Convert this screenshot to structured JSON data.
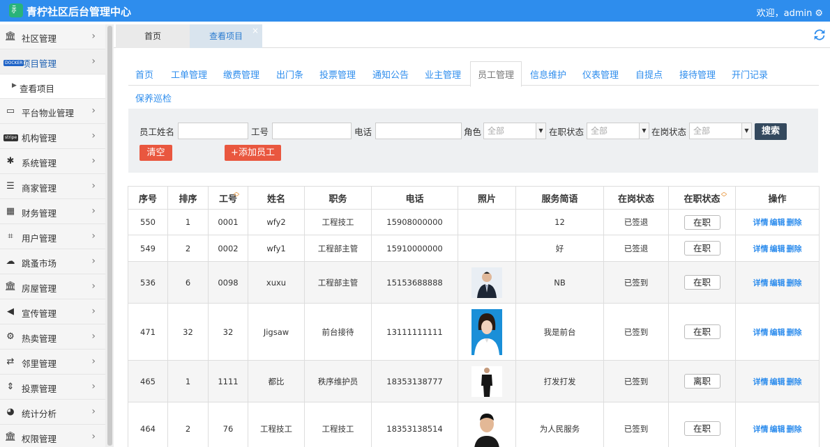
{
  "header": {
    "logo_glyph": "⺬",
    "title": "青柠社区后台管理中心",
    "welcome": "欢迎，admin",
    "settings_icon": "gear-icon"
  },
  "sidebar": {
    "items": [
      {
        "label": "社区管理",
        "icon": "bank-icon"
      },
      {
        "label": "项目管理",
        "icon": "docker-icon",
        "active": true
      },
      {
        "label": "查看项目",
        "sub": true
      },
      {
        "label": "平台物业管理",
        "icon": "desktop-icon"
      },
      {
        "label": "机构管理",
        "icon": "stripe-icon"
      },
      {
        "label": "系统管理",
        "icon": "yelp-icon"
      },
      {
        "label": "商家管理",
        "icon": "bars-icon"
      },
      {
        "label": "财务管理",
        "icon": "calculator-icon"
      },
      {
        "label": "用户管理",
        "icon": "crop-icon"
      },
      {
        "label": "跳蚤市场",
        "icon": "cloud-icon"
      },
      {
        "label": "房屋管理",
        "icon": "bank-icon"
      },
      {
        "label": "宣传管理",
        "icon": "volume-icon"
      },
      {
        "label": "热卖管理",
        "icon": "cog-icon"
      },
      {
        "label": "邻里管理",
        "icon": "retweet-icon"
      },
      {
        "label": "投票管理",
        "icon": "sort-icon"
      },
      {
        "label": "统计分析",
        "icon": "pie-icon"
      },
      {
        "label": "权限管理",
        "icon": "bank-icon"
      }
    ],
    "badge_docker": "DOCKER",
    "badge_stripe": "stripe"
  },
  "tabs": {
    "home": "首页",
    "view": "查看项目",
    "close": "×"
  },
  "subnav": [
    "首页",
    "工单管理",
    "缴费管理",
    "出门条",
    "投票管理",
    "通知公告",
    "业主管理",
    "员工管理",
    "信息维护",
    "仪表管理",
    "自提点",
    "接待管理",
    "开门记录",
    "保养巡检"
  ],
  "filter": {
    "name_label": "员工姓名",
    "id_label": "工号",
    "phone_label": "电话",
    "role_label": "角色",
    "role_value": "全部",
    "job_label": "在职状态",
    "job_value": "全部",
    "post_label": "在岗状态",
    "post_value": "全部",
    "search": "搜索",
    "clear": "清空",
    "add": "+添加员工"
  },
  "table": {
    "headers": [
      "序号",
      "排序",
      "工号",
      "姓名",
      "职务",
      "电话",
      "照片",
      "服务简语",
      "在岗状态",
      "在职状态",
      "操作"
    ],
    "ops": [
      "详情",
      "编辑",
      "删除"
    ],
    "rows": [
      {
        "no": "550",
        "order": "1",
        "id": "0001",
        "name": "wfy2",
        "title": "工程技工",
        "phone": "15908000000",
        "photo": "",
        "motto": "12",
        "post": "已签退",
        "job": "在职"
      },
      {
        "no": "549",
        "order": "2",
        "id": "0002",
        "name": "wfy1",
        "title": "工程部主管",
        "phone": "15910000000",
        "photo": "",
        "motto": "好",
        "post": "已签退",
        "job": "在职"
      },
      {
        "no": "536",
        "order": "6",
        "id": "0098",
        "name": "xuxu",
        "title": "工程部主管",
        "phone": "15153688888",
        "photo": "suit-man",
        "motto": "NB",
        "post": "已签到",
        "job": "在职"
      },
      {
        "no": "471",
        "order": "32",
        "id": "32",
        "name": "Jigsaw",
        "title": "前台接待",
        "phone": "13111111111",
        "photo": "woman",
        "motto": "我是前台",
        "post": "已签到",
        "job": "在职"
      },
      {
        "no": "465",
        "order": "1",
        "id": "1111",
        "name": "都比",
        "title": "秩序维护员",
        "phone": "18353138777",
        "photo": "standing-man",
        "motto": "打发打发",
        "post": "已签到",
        "job": "离职"
      },
      {
        "no": "464",
        "order": "2",
        "id": "76",
        "name": "工程技工",
        "title": "工程技工",
        "phone": "18353138514",
        "photo": "man-portrait",
        "motto": "为人民服务",
        "post": "已签到",
        "job": "在职"
      }
    ]
  }
}
